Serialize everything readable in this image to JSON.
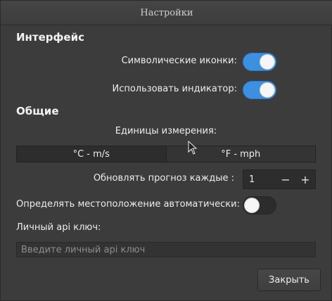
{
  "window": {
    "title": "Настройки"
  },
  "interface": {
    "heading": "Интерфейс",
    "symbolic_icons_label": "Символические иконки:",
    "symbolic_icons_on": true,
    "use_indicator_label": "Использовать индикатор:",
    "use_indicator_on": true
  },
  "general": {
    "heading": "Общие",
    "units_label": "Единицы измерения:",
    "units_options": [
      "°C - m/s",
      "°F - mph"
    ],
    "units_selected": "°C - m/s",
    "update_label": "Обновлять прогноз каждые :",
    "update_value": "1",
    "minus": "−",
    "plus": "+",
    "autolocate_label": "Определять местоположение автоматически:",
    "autolocate_on": false,
    "api_key_label": "Личный api ключ:",
    "api_key_placeholder": "Введите личный api ключ"
  },
  "footer": {
    "close_label": "Закрыть"
  },
  "colors": {
    "accent": "#3d8fe0",
    "background": "#3c3c3c"
  }
}
